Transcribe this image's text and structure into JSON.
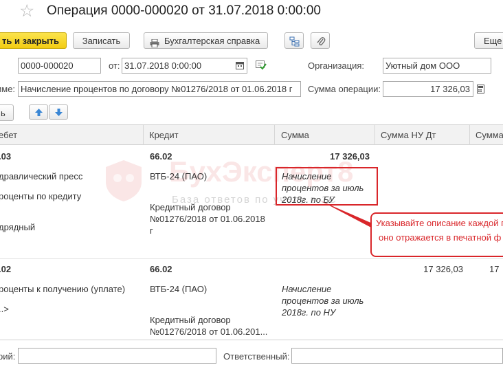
{
  "window": {
    "title": "Операция 0000-000020 от 31.07.2018 0:00:00"
  },
  "toolbar": {
    "post_close_label": "ть и закрыть",
    "save_label": "Записать",
    "report_label": "Бухгалтерская справка",
    "more_label": "Еще"
  },
  "form": {
    "number_value": "0000-000020",
    "date_label": "от:",
    "date_value": "31.07.2018  0:00:00",
    "org_label": "Организация:",
    "org_value": "Уютный дом ООО",
    "content_label": "име:",
    "content_value": "Начисление процентов по договору №01276/2018 от 01.06.2018 г",
    "sum_label": "Сумма операции:",
    "sum_value": "17 326,03"
  },
  "table_toolbar": {
    "add_label": "ь"
  },
  "table": {
    "headers": [
      "ебет",
      "Кредит",
      "Сумма",
      "Сумма НУ Дт",
      "Сумма"
    ],
    "rows": [
      {
        "debit": ".03",
        "debit_sub1": "дравлический пресс",
        "debit_sub2": "роценты по кредиту",
        "debit_sub3": "дрядный",
        "credit": "66.02",
        "credit_sub1": "ВТБ-24 (ПАО)",
        "credit_sub2": "Кредитный договор №01276/2018 от 01.06.2018 г",
        "sum": "17 326,03",
        "content": "Начисление процентов за июль 2018г. по БУ"
      },
      {
        "debit": ".02",
        "debit_sub1": "роценты к получению (уплате)",
        "debit_sub2": "..>",
        "credit": "66.02",
        "credit_sub1": "ВТБ-24 (ПАО)",
        "credit_sub2": "Кредитный договор №01276/2018 от 01.06.201...",
        "content": "Начисление процентов за июль 2018г. по НУ",
        "sum_nu_dt": "17 326,03",
        "sum_cut": "17"
      }
    ]
  },
  "footer": {
    "comment_label": "рий:",
    "responsible_label": "Ответственный:"
  },
  "watermark": {
    "main": "БухЭксперт8",
    "sub": "База ответов по учету в 1С"
  },
  "callout": {
    "line1": "Указывайте описание каждой пр",
    "line2": "оно отражается в печатной ф"
  },
  "colors": {
    "primary_button": "#f3cc12",
    "callout": "#d9262a",
    "watermark": "#dc3c3c"
  }
}
